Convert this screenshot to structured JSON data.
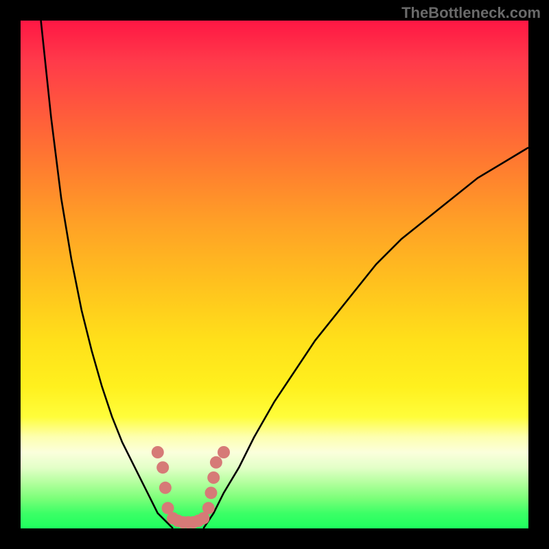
{
  "watermark": "TheBottleneck.com",
  "colors": {
    "background": "#000000",
    "curve": "#000000",
    "marker": "#d67a77"
  },
  "chart_data": {
    "type": "line",
    "title": "",
    "xlabel": "",
    "ylabel": "",
    "xlim": [
      0,
      100
    ],
    "ylim": [
      0,
      100
    ],
    "grid": false,
    "series": [
      {
        "name": "left-curve",
        "x": [
          4,
          6,
          8,
          10,
          12,
          14,
          16,
          18,
          20,
          22,
          24,
          25,
          26,
          27,
          28,
          29,
          30
        ],
        "y": [
          100,
          81,
          65,
          53,
          43,
          35,
          28,
          22,
          17,
          13,
          9,
          7,
          5,
          3,
          2,
          1,
          0
        ]
      },
      {
        "name": "right-curve",
        "x": [
          36,
          38,
          40,
          43,
          46,
          50,
          54,
          58,
          62,
          66,
          70,
          75,
          80,
          85,
          90,
          95,
          100
        ],
        "y": [
          0,
          3,
          7,
          12,
          18,
          25,
          31,
          37,
          42,
          47,
          52,
          57,
          61,
          65,
          69,
          72,
          75
        ]
      }
    ],
    "markers": {
      "name": "bottom-markers",
      "points": [
        {
          "x": 27,
          "y": 15
        },
        {
          "x": 28,
          "y": 12
        },
        {
          "x": 28.5,
          "y": 8
        },
        {
          "x": 29,
          "y": 4
        },
        {
          "x": 30,
          "y": 2
        },
        {
          "x": 31,
          "y": 1.5
        },
        {
          "x": 32,
          "y": 1.2
        },
        {
          "x": 33,
          "y": 1.2
        },
        {
          "x": 34,
          "y": 1.2
        },
        {
          "x": 35,
          "y": 1.5
        },
        {
          "x": 36,
          "y": 2
        },
        {
          "x": 37,
          "y": 4
        },
        {
          "x": 37.5,
          "y": 7
        },
        {
          "x": 38,
          "y": 10
        },
        {
          "x": 38.5,
          "y": 13
        },
        {
          "x": 40,
          "y": 15
        }
      ]
    }
  }
}
